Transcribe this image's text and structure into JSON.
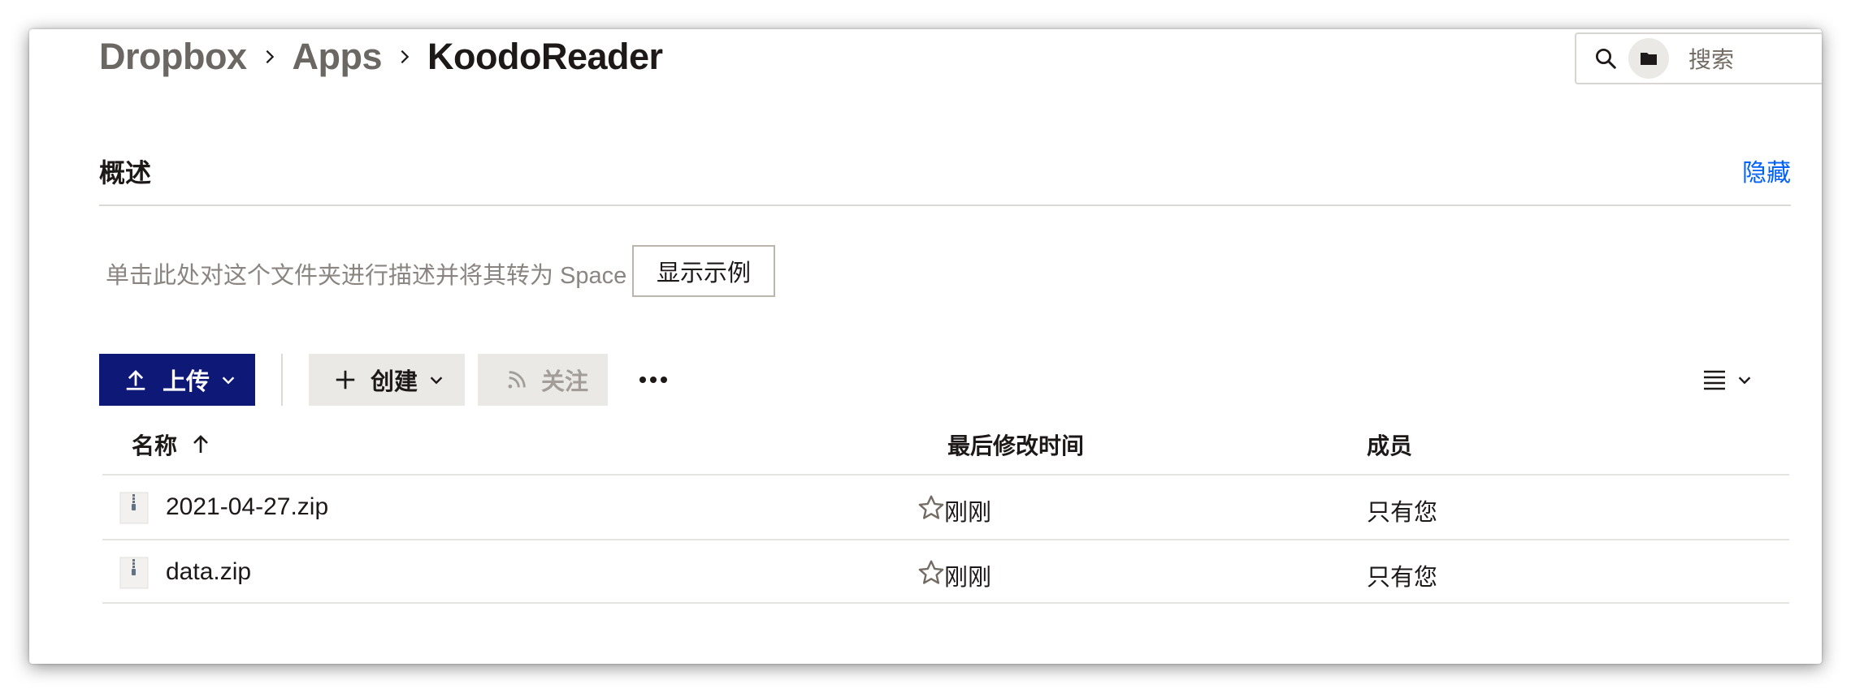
{
  "breadcrumb": {
    "items": [
      "Dropbox",
      "Apps"
    ],
    "current": "KoodoReader"
  },
  "search": {
    "placeholder": "搜索"
  },
  "overview": {
    "title": "概述",
    "hide_label": "隐藏",
    "description": "单击此处对这个文件夹进行描述并将其转为 Space",
    "example_button": "显示示例"
  },
  "toolbar": {
    "upload_label": "上传",
    "create_label": "创建",
    "follow_label": "关注"
  },
  "table": {
    "columns": {
      "name": "名称",
      "modified": "最后修改时间",
      "members": "成员"
    },
    "rows": [
      {
        "name": "2021-04-27.zip",
        "modified": "刚刚",
        "members": "只有您"
      },
      {
        "name": "data.zip",
        "modified": "刚刚",
        "members": "只有您"
      }
    ]
  },
  "colors": {
    "primary_button": "#0d1877",
    "link": "#0061fe",
    "muted_text": "#8a8581"
  },
  "icons": [
    "chevron-right-icon",
    "search-icon",
    "folder-icon",
    "upload-arrow-icon",
    "chevron-down-icon",
    "plus-icon",
    "rss-icon",
    "more-icon",
    "list-view-icon",
    "sort-up-icon",
    "zip-file-icon",
    "star-icon"
  ]
}
